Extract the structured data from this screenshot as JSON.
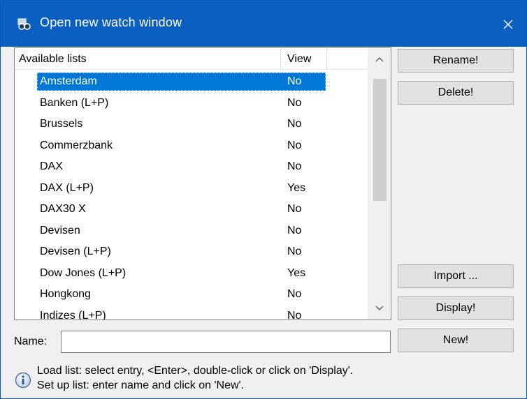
{
  "window": {
    "title": "Open new watch window",
    "icon": "glasses-icon"
  },
  "list": {
    "headers": {
      "name": "Available lists",
      "view": "View"
    },
    "selected_index": 0,
    "rows": [
      {
        "name": "Amsterdam",
        "view": "No"
      },
      {
        "name": "Banken (L+P)",
        "view": "No"
      },
      {
        "name": "Brussels",
        "view": "No"
      },
      {
        "name": "Commerzbank",
        "view": "No"
      },
      {
        "name": "DAX",
        "view": "No"
      },
      {
        "name": "DAX (L+P)",
        "view": "Yes"
      },
      {
        "name": "DAX30 X",
        "view": "No"
      },
      {
        "name": "Devisen",
        "view": "No"
      },
      {
        "name": "Devisen (L+P)",
        "view": "No"
      },
      {
        "name": "Dow Jones (L+P)",
        "view": "Yes"
      },
      {
        "name": "Hongkong",
        "view": "No"
      },
      {
        "name": "Indizes (L+P)",
        "view": "No"
      }
    ]
  },
  "buttons": {
    "rename": "Rename!",
    "delete": "Delete!",
    "import": "Import ...",
    "display": "Display!",
    "new": "New!"
  },
  "name_field": {
    "label": "Name:",
    "value": ""
  },
  "info": {
    "line1": "Load list: select entry, <Enter>, double-click or click on 'Display'.",
    "line2": "Set up list: enter name and click on 'New'."
  },
  "colors": {
    "titlebar": "#0b5fc1",
    "selection": "#0078d7"
  }
}
